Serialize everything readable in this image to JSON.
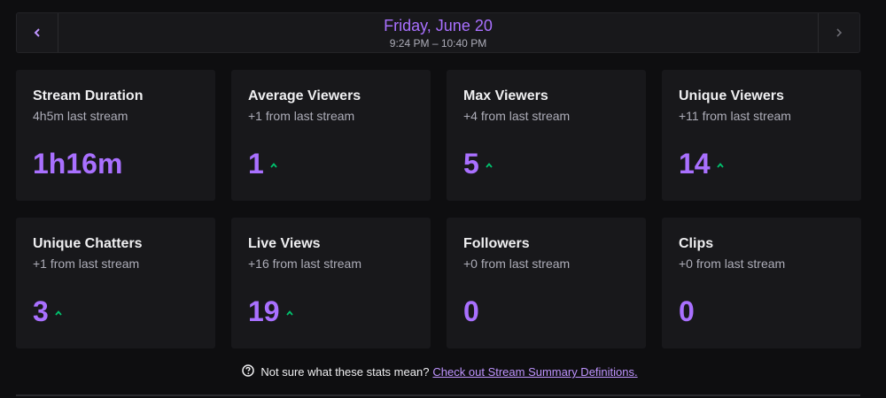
{
  "header": {
    "date_title": "Friday, June 20",
    "time_range": "9:24 PM – 10:40 PM"
  },
  "colors": {
    "accent": "#a970ff",
    "trend_up": "#00c26e",
    "card_bg": "#18181b",
    "page_bg": "#0e0e10"
  },
  "stats": [
    {
      "title": "Stream Duration",
      "subtitle": "4h5m last stream",
      "value": "1h16m",
      "trend": "none"
    },
    {
      "title": "Average Viewers",
      "subtitle": "+1 from last stream",
      "value": "1",
      "trend": "up"
    },
    {
      "title": "Max Viewers",
      "subtitle": "+4 from last stream",
      "value": "5",
      "trend": "up"
    },
    {
      "title": "Unique Viewers",
      "subtitle": "+11 from last stream",
      "value": "14",
      "trend": "up"
    },
    {
      "title": "Unique Chatters",
      "subtitle": "+1 from last stream",
      "value": "3",
      "trend": "up"
    },
    {
      "title": "Live Views",
      "subtitle": "+16 from last stream",
      "value": "19",
      "trend": "up"
    },
    {
      "title": "Followers",
      "subtitle": "+0 from last stream",
      "value": "0",
      "trend": "none"
    },
    {
      "title": "Clips",
      "subtitle": "+0 from last stream",
      "value": "0",
      "trend": "none"
    }
  ],
  "help": {
    "text": "Not sure what these stats mean?",
    "link_text": "Check out Stream Summary Definitions."
  },
  "icons": {
    "prev": "chevron-left-icon",
    "next": "chevron-right-icon",
    "trend": "trend-up-icon",
    "help": "question-circle-icon"
  }
}
